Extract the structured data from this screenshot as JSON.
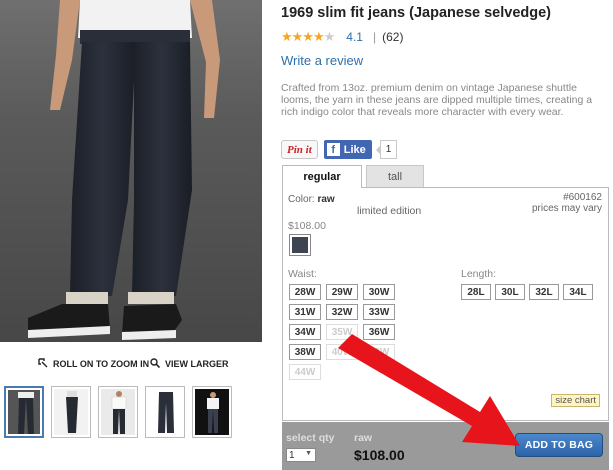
{
  "product": {
    "title": "1969 slim fit jeans (Japanese selvedge)",
    "rating_stars": 4.1,
    "rating_score": "4.1",
    "rating_sep": "|",
    "review_count": "(62)",
    "write_review": "Write a review",
    "description": "Crafted from 13oz. premium denim on vintage Japanese shuttle looms, the yarn in these jeans are dipped multiple times, creating a rich indigo color that reveals more character with every wear."
  },
  "media": {
    "zoom_label": "ROLL ON TO ZOOM IN",
    "larger_label": "VIEW LARGER",
    "thumbnails": [
      "front",
      "side",
      "full-shirt",
      "flat",
      "pair"
    ]
  },
  "social": {
    "pinit": "Pin it",
    "like": "Like",
    "like_count": "1"
  },
  "tabs": {
    "regular": "regular",
    "tall": "tall"
  },
  "panel": {
    "color_label": "Color:",
    "color_value": "raw",
    "edition": "limited edition",
    "sku": "#600162",
    "sku_note": "prices may vary",
    "price": "$108.00",
    "swatch_color": "#3d4552",
    "waist_label": "Waist:",
    "length_label": "Length:",
    "waist_sizes": [
      {
        "label": "28W",
        "available": true
      },
      {
        "label": "29W",
        "available": true
      },
      {
        "label": "30W",
        "available": true
      },
      {
        "label": "31W",
        "available": true
      },
      {
        "label": "32W",
        "available": true
      },
      {
        "label": "33W",
        "available": true
      },
      {
        "label": "34W",
        "available": true
      },
      {
        "label": "35W",
        "available": false
      },
      {
        "label": "36W",
        "available": true
      },
      {
        "label": "38W",
        "available": true
      },
      {
        "label": "40W",
        "available": false
      },
      {
        "label": "42W",
        "available": false
      },
      {
        "label": "44W",
        "available": false
      }
    ],
    "length_sizes": [
      "28L",
      "30L",
      "32L",
      "34L"
    ],
    "size_chart": "size chart"
  },
  "buybar": {
    "qty_label": "select qty",
    "qty_value": "1",
    "color": "raw",
    "price": "$108.00",
    "add_to_bag": "ADD TO BAG"
  },
  "colors": {
    "link": "#2f6ea8",
    "star": "#f5a623",
    "button": "#2d64a8",
    "arrow": "#e8141b"
  }
}
